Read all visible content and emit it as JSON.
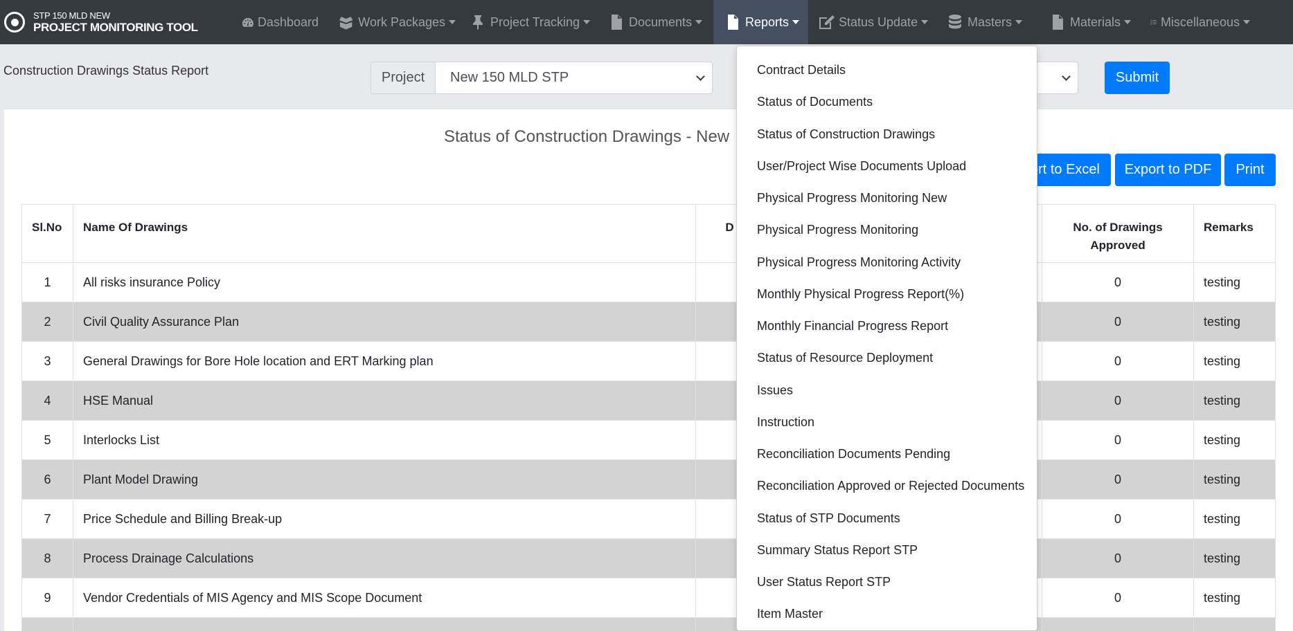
{
  "brand": {
    "sub": "STP 150 MLD NEW",
    "main": "PROJECT MONITORING TOOL"
  },
  "nav": {
    "dashboard": "Dashboard",
    "work_packages": "Work Packages",
    "project_tracking": "Project Tracking",
    "documents": "Documents",
    "reports": "Reports",
    "status_update": "Status Update",
    "masters": "Masters",
    "materials": "Materials",
    "miscellaneous": "Miscellaneous"
  },
  "page": {
    "title": "Construction Drawings Status Report"
  },
  "filter": {
    "project_label": "Project",
    "project_value": "New 150 MLD STP",
    "submit": "Submit"
  },
  "report": {
    "heading": "Status of Construction Drawings - New",
    "export_excel": "Export to Excel",
    "export_pdf": "Export to PDF",
    "print": "Print"
  },
  "table": {
    "headers": {
      "slno": "Sl.No",
      "name": "Name Of Drawings",
      "d": "D",
      "approved_line1": "No. of Drawings",
      "approved_line2": "Approved",
      "remarks": "Remarks"
    },
    "rows": [
      {
        "no": "1",
        "name": "All risks insurance Policy",
        "approved": "0",
        "remarks": "testing"
      },
      {
        "no": "2",
        "name": "Civil Quality Assurance Plan",
        "approved": "0",
        "remarks": "testing"
      },
      {
        "no": "3",
        "name": "General Drawings for Bore Hole location and ERT Marking plan",
        "approved": "0",
        "remarks": "testing"
      },
      {
        "no": "4",
        "name": "HSE Manual",
        "approved": "0",
        "remarks": "testing"
      },
      {
        "no": "5",
        "name": "Interlocks List",
        "approved": "0",
        "remarks": "testing"
      },
      {
        "no": "6",
        "name": "Plant Model Drawing",
        "approved": "0",
        "remarks": "testing"
      },
      {
        "no": "7",
        "name": "Price Schedule and Billing Break-up",
        "approved": "0",
        "remarks": "testing"
      },
      {
        "no": "8",
        "name": "Process Drainage Calculations",
        "approved": "0",
        "remarks": "testing"
      },
      {
        "no": "9",
        "name": "Vendor Credentials of MIS Agency and MIS Scope Document",
        "approved": "0",
        "remarks": "testing"
      }
    ]
  },
  "reports_menu": [
    "Contract Details",
    "Status of Documents",
    "Status of Construction Drawings",
    "User/Project Wise Documents Upload",
    "Physical Progress Monitoring New",
    "Physical Progress Monitoring",
    "Physical Progress Monitoring Activity",
    "Monthly Physical Progress Report(%)",
    "Monthly Financial Progress Report",
    "Status of Resource Deployment",
    "Issues",
    "Instruction",
    "Reconciliation Documents Pending",
    "Reconciliation Approved or Rejected Documents",
    "Status of STP Documents",
    "Summary Status Report STP",
    "User Status Report STP",
    "Item Master"
  ]
}
